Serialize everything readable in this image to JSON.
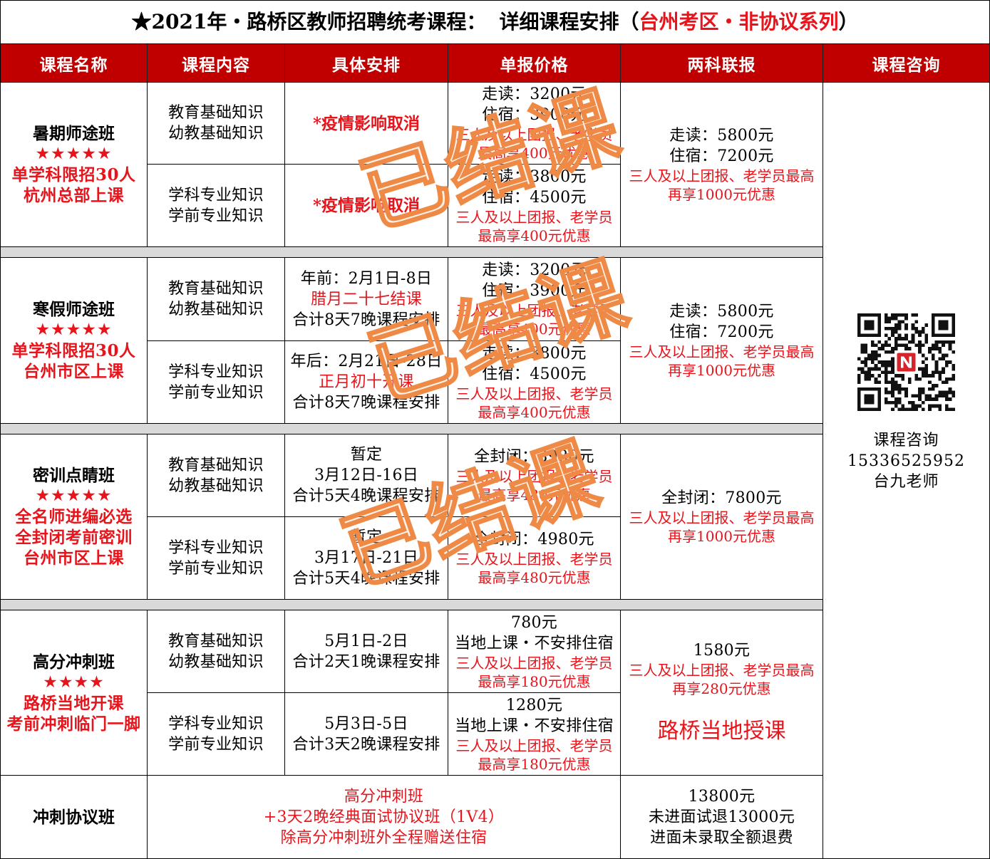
{
  "colors": {
    "header_bg": "#c00000",
    "accent": "#e8141b",
    "divider": "#d9d9d9",
    "stamp": "#ee8a46"
  },
  "title": {
    "main": "★2021年・路桥区教师招聘统考课程：",
    "detail": "详细课程安排（",
    "highlight": "台州考区・非协议系列",
    "close": "）"
  },
  "headers": [
    "课程名称",
    "课程内容",
    "具体安排",
    "单报价格",
    "两科联报",
    "课程咨询"
  ],
  "courses": [
    {
      "name": "暑期师途班",
      "stars": "★★★★★",
      "notes": [
        "单学科限招30人",
        "杭州总部上课"
      ],
      "parts": [
        {
          "content": [
            "教育基础知识",
            "幼教基础知识"
          ],
          "schedule": [
            "*疫情影响取消"
          ],
          "price": [
            "走读：3200元",
            "住宿：3900元"
          ],
          "discount": [
            "三人及以上团报、老学员",
            "最高享400元优惠"
          ]
        },
        {
          "content": [
            "学科专业知识",
            "学前专业知识"
          ],
          "schedule": [
            "*疫情影响取消"
          ],
          "price": [
            "走读：3800元",
            "住宿：4500元"
          ],
          "discount": [
            "三人及以上团报、老学员",
            "最高享400元优惠"
          ]
        }
      ],
      "combo": {
        "price": [
          "走读：5800元",
          "住宿：7200元"
        ],
        "discount": [
          "三人及以上团报、老学员最高",
          "再享1000元优惠"
        ]
      }
    },
    {
      "name": "寒假师途班",
      "stars": "★★★★★",
      "notes": [
        "单学科限招30人",
        "台州市区上课"
      ],
      "parts": [
        {
          "content": [
            "教育基础知识",
            "幼教基础知识"
          ],
          "schedule": [
            "年前：2月1日-8日",
            "腊月二十七结课",
            "合计8天7晚课程安排"
          ],
          "price": [
            "走读：3200元",
            "住宿：3900元"
          ],
          "discount": [
            "三人及以上团报、老学员",
            "最高享400元优惠"
          ]
        },
        {
          "content": [
            "学科专业知识",
            "学前专业知识"
          ],
          "schedule": [
            "年后：2月21日-28日",
            "正月初十开课",
            "合计8天7晚课程安排"
          ],
          "price": [
            "走读：3800元",
            "住宿：4500元"
          ],
          "discount": [
            "三人及以上团报、老学员",
            "最高享400元优惠"
          ]
        }
      ],
      "combo": {
        "price": [
          "走读：5800元",
          "住宿：7200元"
        ],
        "discount": [
          "三人及以上团报、老学员最高",
          "再享1000元优惠"
        ]
      }
    },
    {
      "name": "密训点睛班",
      "stars": "★★★★★",
      "notes": [
        "全名师进编必选",
        "全封闭考前密训",
        "台州市区上课"
      ],
      "parts": [
        {
          "content": [
            "教育基础知识",
            "幼教基础知识"
          ],
          "schedule": [
            "暂定",
            "3月12日-16日",
            "合计5天4晚课程安排"
          ],
          "price": [
            "全封闭：3980元"
          ],
          "discount": [
            "三人及以上团报、老学员",
            "最高享480元优惠"
          ]
        },
        {
          "content": [
            "学科专业知识",
            "学前专业知识"
          ],
          "schedule": [
            "暂定",
            "3月17日-21日",
            "合计5天4晚课程安排"
          ],
          "price": [
            "全封闭：4980元"
          ],
          "discount": [
            "三人及以上团报、老学员",
            "最高享480元优惠"
          ]
        }
      ],
      "combo": {
        "price": [
          "全封闭：7800元"
        ],
        "discount": [
          "三人及以上团报、老学员最高",
          "再享1000元优惠"
        ]
      }
    },
    {
      "name": "高分冲刺班",
      "stars": "★★★★",
      "notes": [
        "路桥当地开课",
        "考前冲刺临门一脚"
      ],
      "parts": [
        {
          "content": [
            "教育基础知识",
            "幼教基础知识"
          ],
          "schedule": [
            "5月1日-2日",
            "合计2天1晚课程安排"
          ],
          "price": [
            "780元",
            "当地上课・不安排住宿"
          ],
          "discount": [
            "三人及以上团报、老学员",
            "最高享180元优惠"
          ]
        },
        {
          "content": [
            "学科专业知识",
            "学前专业知识"
          ],
          "schedule": [
            "5月3日-5日",
            "合计3天2晚课程安排"
          ],
          "price": [
            "1280元",
            "当地上课・不安排住宿"
          ],
          "discount": [
            "三人及以上团报、老学员",
            "最高享180元优惠"
          ]
        }
      ],
      "combo": {
        "price": [
          "1580元"
        ],
        "discount": [
          "三人及以上团报、老学员最高",
          "再享280元优惠"
        ],
        "highlight": "路桥当地授课"
      }
    }
  ],
  "protocol": {
    "name": "冲刺协议班",
    "details": [
      "高分冲刺班",
      "+3天2晚经典面试协议班（1V4）",
      "除高分冲刺班外全程赠送住宿"
    ],
    "price": [
      "13800元",
      "未进面试退13000元",
      "进面未录取全额退费"
    ]
  },
  "consult": {
    "label": "课程咨询",
    "phone": "15336525952",
    "contact": "台九老师"
  },
  "stamps": [
    "已结课",
    "已结课",
    "已结课"
  ]
}
